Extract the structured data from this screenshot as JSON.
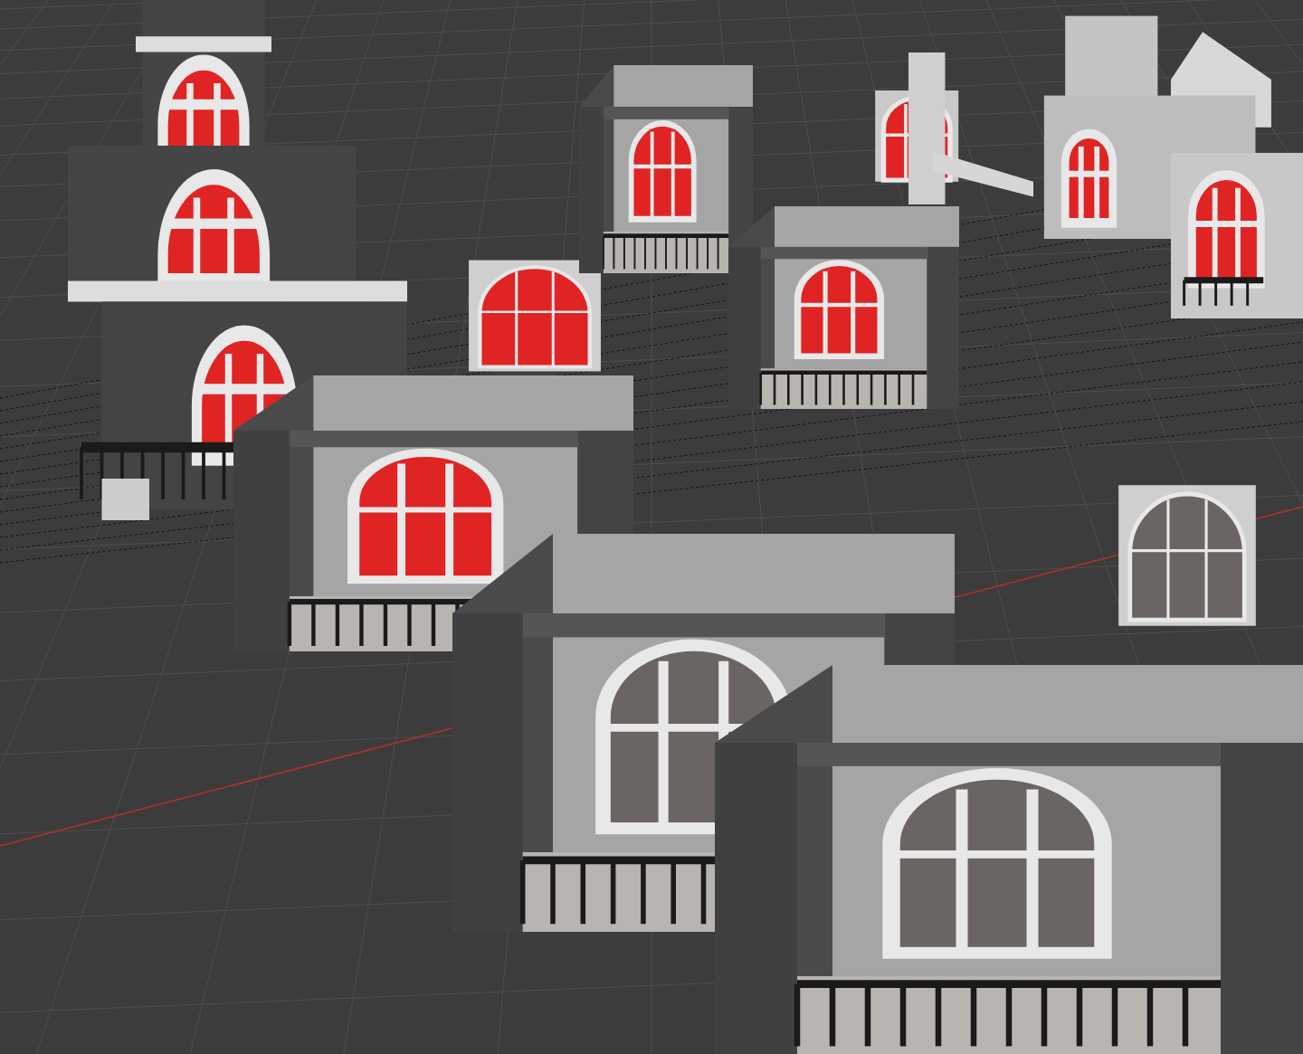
{
  "viewport": {
    "objects": [
      {
        "kind": "tower",
        "highlighted": true
      },
      {
        "kind": "window",
        "highlighted": true
      },
      {
        "kind": "room",
        "highlighted": true
      },
      {
        "kind": "chimney",
        "highlighted": true
      },
      {
        "kind": "room",
        "highlighted": true
      },
      {
        "kind": "house",
        "highlighted": true
      },
      {
        "kind": "room",
        "highlighted": true
      },
      {
        "kind": "window",
        "highlighted": false
      },
      {
        "kind": "room",
        "highlighted": false
      },
      {
        "kind": "room",
        "highlighted": false
      }
    ]
  }
}
